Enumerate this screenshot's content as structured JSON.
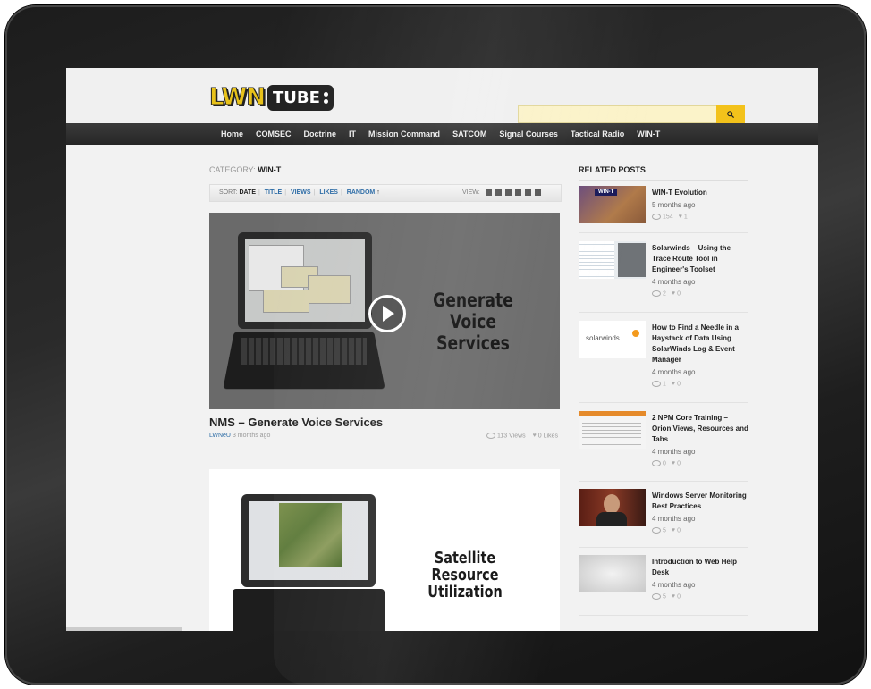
{
  "header": {
    "logo_main": "LWN",
    "logo_tube": "TUBE",
    "search_icon": "search-icon"
  },
  "nav": {
    "items": [
      "Home",
      "COMSEC",
      "Doctrine",
      "IT",
      "Mission Command",
      "SATCOM",
      "Signal Courses",
      "Tactical Radio",
      "WIN-T"
    ]
  },
  "category": {
    "prefix": "CATEGORY:",
    "name": "WIN-T"
  },
  "sortbar": {
    "label": "SORT:",
    "items": [
      "DATE",
      "TITLE",
      "VIEWS",
      "LIKES",
      "RANDOM"
    ],
    "random_arrow": "↑",
    "view_label": "VIEW:"
  },
  "posts": [
    {
      "thumb_title": "Generate Voice Services",
      "title": "NMS – Generate Voice Services",
      "author": "LWNeU",
      "date": "3 months ago",
      "views": "113 Views",
      "likes": "0 Likes"
    },
    {
      "thumb_title": "Satellite Resource Utilization"
    }
  ],
  "sidebar": {
    "heading": "RELATED POSTS",
    "items": [
      {
        "title": "WIN-T Evolution",
        "date": "5 months ago",
        "views": "154",
        "likes": "1",
        "thumb_label": "WIN-T"
      },
      {
        "title": "Solarwinds – Using the Trace Route Tool in Engineer's Toolset",
        "date": "4 months ago",
        "views": "2",
        "likes": "0"
      },
      {
        "title": "How to Find a Needle in a Haystack of Data Using SolarWinds Log & Event Manager",
        "date": "4 months ago",
        "views": "1",
        "likes": "0",
        "thumb_label": "solarwinds"
      },
      {
        "title": "2 NPM Core Training – Orion Views, Resources and Tabs",
        "date": "4 months ago",
        "views": "0",
        "likes": "0"
      },
      {
        "title": "Windows Server Monitoring Best Practices",
        "date": "4 months ago",
        "views": "5",
        "likes": "0"
      },
      {
        "title": "Introduction to Web Help Desk",
        "date": "4 months ago",
        "views": "5",
        "likes": "0"
      }
    ]
  }
}
